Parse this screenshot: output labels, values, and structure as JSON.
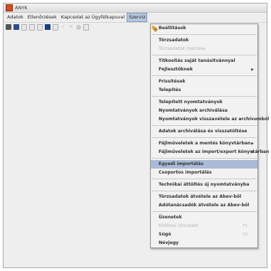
{
  "window": {
    "title": "ÁNYK"
  },
  "menubar": {
    "items": [
      "Adatok",
      "Ellenőrzések",
      "Kapcsolat az Ügyfélkapuval",
      "Szerviz"
    ],
    "active": "Szerviz"
  },
  "toolbar": {
    "icons": [
      "folder-icon",
      "save-icon",
      "doc-icon",
      "doc-icon",
      "doc-icon",
      "calculator-icon",
      "doc-icon",
      "check-icon",
      "x-icon",
      "find-icon",
      "doc-icon"
    ]
  },
  "service_menu": {
    "groups": [
      [
        {
          "label": "Beállítások",
          "enabled": true,
          "icon": "settings-icon"
        }
      ],
      [
        {
          "label": "Törzsadatok",
          "enabled": true
        },
        {
          "label": "Törzsadatok mentése",
          "enabled": false
        }
      ],
      [
        {
          "label": "Titkosítás saját tanúsítvánnyal",
          "enabled": true
        },
        {
          "label": "Fejlesztőknek",
          "enabled": true,
          "submenu": true
        }
      ],
      [
        {
          "label": "Frissítések",
          "enabled": true
        },
        {
          "label": "Telepítés",
          "enabled": true
        }
      ],
      [
        {
          "label": "Telepített nyomtatványok",
          "enabled": true
        },
        {
          "label": "Nyomtatványok archiválása",
          "enabled": true
        },
        {
          "label": "Nyomtatványok visszavétele az archívumból",
          "enabled": true
        }
      ],
      [
        {
          "label": "Adatok archiválása és visszatöltése",
          "enabled": true
        }
      ],
      [
        {
          "label": "Fájlműveletek a mentés könyvtárban",
          "enabled": true,
          "submenu": true
        },
        {
          "label": "Fájlműveletek az import/export könyvtárban",
          "enabled": true,
          "submenu": true
        }
      ],
      [
        {
          "label": "Egyedi importálás",
          "enabled": true,
          "highlighted": true
        },
        {
          "label": "Csoportos importálás",
          "enabled": true
        }
      ],
      [
        {
          "label": "Technikai áttöltés új nyomtatványba",
          "enabled": true
        }
      ],
      [
        {
          "label": "Törzsadatok átvétele az Abev-ből",
          "enabled": true
        },
        {
          "label": "Adótanácsadók átvétele az Abev-ből",
          "enabled": true
        }
      ],
      [
        {
          "label": "Üzenetek",
          "enabled": true
        },
        {
          "label": "Kitöltési útmutató",
          "enabled": false,
          "shortcut": "F1"
        },
        {
          "label": "Súgó",
          "enabled": true,
          "shortcut": "F2"
        },
        {
          "label": "Névjegy",
          "enabled": true
        }
      ]
    ]
  },
  "colors": {
    "highlight": "#aabbd7",
    "menu_bg": "#f2f2f2",
    "disabled_text": "#b4b4b4"
  }
}
